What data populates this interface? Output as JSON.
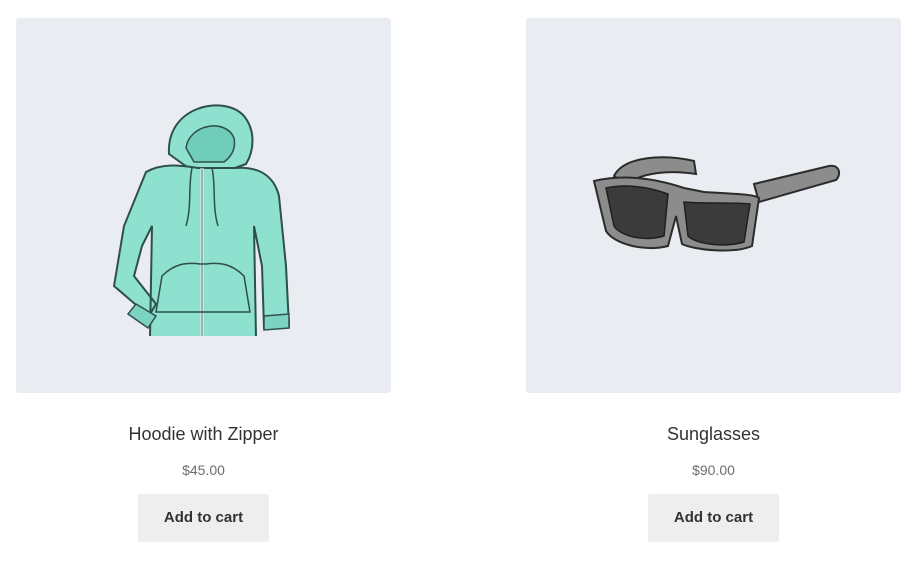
{
  "products": [
    {
      "title": "Hoodie with Zipper",
      "price": "$45.00",
      "button_label": "Add to cart",
      "image_icon": "hoodie-image",
      "image_color": "#8ee0cf"
    },
    {
      "title": "Sunglasses",
      "price": "$90.00",
      "button_label": "Add to cart",
      "image_icon": "sunglasses-image",
      "image_color": "#8c8c8c"
    }
  ],
  "colors": {
    "thumb_background": "#e9edf1",
    "button_background": "#eeeeee",
    "text": "#333333",
    "price_text": "#6d6d6d"
  }
}
